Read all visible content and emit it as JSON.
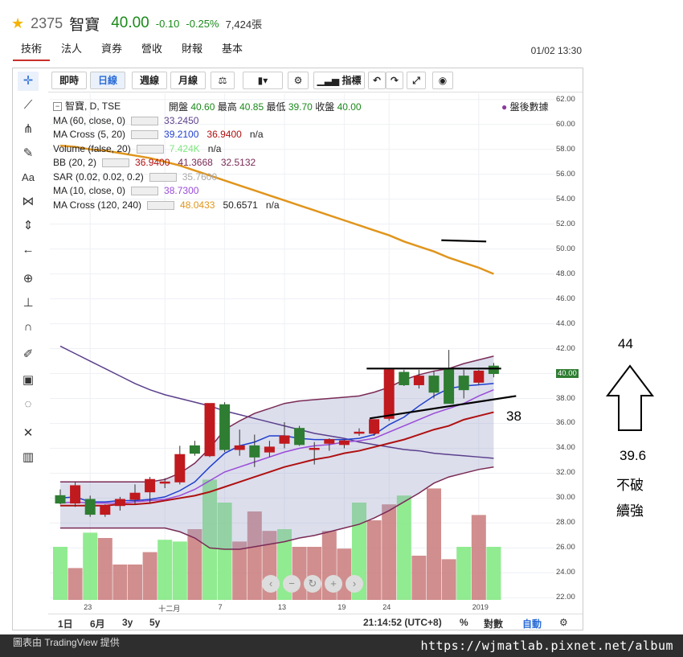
{
  "header": {
    "code": "2375",
    "name": "智寶",
    "price": "40.00",
    "change": "-0.10",
    "change_pct": "-0.25%",
    "volume": "7,424張",
    "star_icon": "star-icon"
  },
  "tabs": [
    "技術",
    "法人",
    "資券",
    "營收",
    "財報",
    "基本"
  ],
  "timestamp": "01/02 13:30",
  "toolbar": {
    "buttons": [
      "即時",
      "日線",
      "週線",
      "月線",
      "指標"
    ],
    "selected": "日線"
  },
  "legend": {
    "symbol": "智寶, D, TSE",
    "ohlc": {
      "open_label": "開盤",
      "open": "40.60",
      "high_label": "最高",
      "high": "40.85",
      "low_label": "最低",
      "low": "39.70",
      "close_label": "收盤",
      "close": "40.00"
    },
    "after_hours": "盤後數據",
    "rows": [
      {
        "label": "MA (60, close, 0)",
        "values": [
          "33.2450"
        ],
        "colors": [
          "#5b3f8c"
        ]
      },
      {
        "label": "MA Cross (5, 20)",
        "values": [
          "39.2100",
          "36.9400",
          "n/a"
        ],
        "colors": [
          "#1f3fcf",
          "#b01010",
          "#222"
        ]
      },
      {
        "label": "Volume (false, 20)",
        "values": [
          "7.424K",
          "n/a"
        ],
        "colors": [
          "#7ee87e",
          "#222"
        ]
      },
      {
        "label": "BB (20, 2)",
        "values": [
          "36.9400",
          "41.3668",
          "32.5132"
        ],
        "colors": [
          "#b01010",
          "#7a2a55",
          "#7a2a55"
        ]
      },
      {
        "label": "SAR (0.02, 0.02, 0.2)",
        "values": [
          "35.7600"
        ],
        "colors": [
          "#aaa"
        ]
      },
      {
        "label": "MA (10, close, 0)",
        "values": [
          "38.7300"
        ],
        "colors": [
          "#9a4ad8"
        ]
      },
      {
        "label": "MA Cross (120, 240)",
        "values": [
          "48.0433",
          "50.6571",
          "n/a"
        ],
        "colors": [
          "#e0951c",
          "#222",
          "#222"
        ]
      }
    ]
  },
  "chart_data": {
    "type": "candlestick",
    "symbol": "智寶, D, TSE",
    "y_ticks": [
      "62.00",
      "60.00",
      "58.00",
      "56.00",
      "54.00",
      "52.00",
      "50.00",
      "48.00",
      "46.00",
      "44.00",
      "42.00",
      "40.00",
      "38.00",
      "36.00",
      "34.00",
      "32.00",
      "30.00",
      "28.00",
      "26.00",
      "24.00",
      "22.00"
    ],
    "ylim": [
      21.7,
      62.5
    ],
    "current_price": "40.00",
    "x_ticks": [
      {
        "label": "23",
        "i": 2
      },
      {
        "label": "十二月",
        "i": 7
      },
      {
        "label": "7",
        "i": 11
      },
      {
        "label": "13",
        "i": 15
      },
      {
        "label": "19",
        "i": 19
      },
      {
        "label": "24",
        "i": 22
      },
      {
        "label": "2019",
        "i": 28
      }
    ],
    "candles": [
      {
        "o": 30.2,
        "h": 30.7,
        "l": 29.5,
        "c": 29.6
      },
      {
        "o": 29.6,
        "h": 31.3,
        "l": 29.3,
        "c": 31.0
      },
      {
        "o": 29.9,
        "h": 30.2,
        "l": 28.5,
        "c": 28.7
      },
      {
        "o": 28.7,
        "h": 29.5,
        "l": 28.5,
        "c": 29.4
      },
      {
        "o": 29.4,
        "h": 30.1,
        "l": 29.0,
        "c": 29.9
      },
      {
        "o": 29.9,
        "h": 31.1,
        "l": 29.5,
        "c": 30.4
      },
      {
        "o": 30.5,
        "h": 31.7,
        "l": 29.6,
        "c": 31.5
      },
      {
        "o": 31.2,
        "h": 31.6,
        "l": 30.8,
        "c": 31.3
      },
      {
        "o": 31.3,
        "h": 34.2,
        "l": 31.1,
        "c": 33.5
      },
      {
        "o": 34.2,
        "h": 34.6,
        "l": 33.4,
        "c": 33.6
      },
      {
        "o": 33.4,
        "h": 37.6,
        "l": 33.3,
        "c": 37.6
      },
      {
        "o": 37.5,
        "h": 37.7,
        "l": 33.7,
        "c": 33.9
      },
      {
        "o": 33.9,
        "h": 35.5,
        "l": 33.4,
        "c": 34.2
      },
      {
        "o": 34.2,
        "h": 35.1,
        "l": 32.5,
        "c": 33.3
      },
      {
        "o": 33.7,
        "h": 34.6,
        "l": 33.3,
        "c": 34.1
      },
      {
        "o": 34.4,
        "h": 36.1,
        "l": 34.0,
        "c": 35.0
      },
      {
        "o": 35.6,
        "h": 35.8,
        "l": 34.2,
        "c": 34.3
      },
      {
        "o": 34.0,
        "h": 34.5,
        "l": 32.7,
        "c": 34.0
      },
      {
        "o": 34.4,
        "h": 34.8,
        "l": 33.8,
        "c": 34.7
      },
      {
        "o": 34.3,
        "h": 34.7,
        "l": 34.0,
        "c": 34.6
      },
      {
        "o": 35.3,
        "h": 35.6,
        "l": 35.0,
        "c": 35.3
      },
      {
        "o": 35.2,
        "h": 36.3,
        "l": 35.0,
        "c": 36.3
      },
      {
        "o": 36.4,
        "h": 40.4,
        "l": 36.2,
        "c": 40.3
      },
      {
        "o": 40.1,
        "h": 40.3,
        "l": 39.0,
        "c": 39.1
      },
      {
        "o": 39.1,
        "h": 40.3,
        "l": 38.8,
        "c": 39.8
      },
      {
        "o": 39.8,
        "h": 40.2,
        "l": 38.0,
        "c": 38.5
      },
      {
        "o": 40.3,
        "h": 41.9,
        "l": 37.6,
        "c": 37.6
      },
      {
        "o": 39.8,
        "h": 40.3,
        "l": 38.0,
        "c": 38.7
      },
      {
        "o": 39.3,
        "h": 40.3,
        "l": 39.1,
        "c": 40.2
      },
      {
        "o": 40.6,
        "h": 40.85,
        "l": 39.7,
        "c": 40.0
      }
    ],
    "volume": [
      3.0,
      1.8,
      3.8,
      3.5,
      2.0,
      2.0,
      2.7,
      3.4,
      3.3,
      4.0,
      6.8,
      5.5,
      3.3,
      5.0,
      3.9,
      4.0,
      3.0,
      3.0,
      3.9,
      2.9,
      5.5,
      4.5,
      5.4,
      5.9,
      2.5,
      6.3,
      2.3,
      3.0,
      4.8,
      3.0
    ],
    "volume_up": [
      false,
      true,
      false,
      true,
      true,
      true,
      true,
      false,
      false,
      true,
      false,
      false,
      true,
      true,
      true,
      false,
      true,
      true,
      true,
      true,
      false,
      true,
      true,
      false,
      true,
      true,
      true,
      false,
      true,
      false
    ],
    "series": [
      {
        "name": "MA (60, close, 0)",
        "color": "#5b3f8c",
        "values": [
          42.2,
          41.6,
          41.0,
          40.4,
          39.8,
          39.2,
          38.7,
          38.3,
          38.0,
          37.7,
          37.4,
          37.0,
          36.7,
          36.4,
          36.1,
          35.8,
          35.5,
          35.2,
          35.0,
          34.8,
          34.5,
          34.3,
          34.1,
          33.9,
          33.8,
          33.6,
          33.5,
          33.4,
          33.3,
          33.2
        ]
      },
      {
        "name": "MA Cross (5, 20) 5",
        "color": "#1f3fcf",
        "values": [
          30.0,
          30.1,
          29.7,
          29.7,
          29.8,
          29.8,
          29.9,
          30.1,
          30.6,
          31.3,
          32.5,
          33.6,
          34.2,
          34.5,
          35.0,
          35.0,
          34.8,
          34.7,
          34.7,
          34.7,
          34.8,
          35.1,
          35.9,
          36.5,
          37.4,
          38.2,
          38.8,
          39.0,
          39.1,
          39.2
        ]
      },
      {
        "name": "MA Cross (5, 20) 20",
        "color": "#b01010",
        "values": [
          29.4,
          29.4,
          29.4,
          29.4,
          29.5,
          29.5,
          29.6,
          29.8,
          30.0,
          30.2,
          30.5,
          30.9,
          31.3,
          31.7,
          32.1,
          32.5,
          32.8,
          33.1,
          33.3,
          33.6,
          33.8,
          34.1,
          34.4,
          34.7,
          35.1,
          35.5,
          35.8,
          36.3,
          36.6,
          36.9
        ]
      },
      {
        "name": "MA (10, close, 0)",
        "color": "#9a4ad8",
        "values": [
          29.6,
          29.7,
          29.6,
          29.6,
          29.6,
          29.7,
          29.8,
          29.9,
          30.2,
          30.7,
          31.4,
          32.1,
          32.5,
          32.9,
          33.3,
          33.7,
          34.0,
          34.2,
          34.3,
          34.5,
          34.6,
          34.8,
          35.3,
          35.8,
          36.3,
          36.8,
          37.2,
          37.6,
          38.2,
          38.7
        ]
      },
      {
        "name": "BB (20, 2) upper",
        "color": "#7a2a55",
        "values": [
          31.3,
          31.3,
          31.3,
          31.3,
          31.3,
          31.3,
          31.3,
          31.5,
          32.0,
          32.8,
          34.0,
          35.5,
          36.2,
          36.8,
          37.2,
          37.6,
          37.8,
          37.9,
          38.0,
          38.1,
          38.2,
          38.5,
          38.9,
          39.5,
          39.9,
          40.2,
          40.4,
          40.8,
          41.1,
          41.4
        ]
      },
      {
        "name": "BB (20, 2) lower",
        "color": "#7a2a55",
        "values": [
          27.6,
          27.6,
          27.6,
          27.6,
          27.6,
          27.6,
          27.6,
          27.6,
          27.3,
          26.8,
          26.0,
          25.9,
          25.9,
          26.1,
          26.3,
          26.5,
          26.8,
          27.0,
          27.3,
          27.6,
          27.9,
          28.4,
          29.0,
          29.7,
          30.4,
          31.2,
          31.7,
          32.0,
          32.3,
          32.5
        ]
      },
      {
        "name": "MA Cross (120, 240) 120",
        "color": "#e0951c",
        "values": [
          58.3,
          58.2,
          58.0,
          57.9,
          57.7,
          57.5,
          57.3,
          57.0,
          56.7,
          56.3,
          55.9,
          55.5,
          55.1,
          54.7,
          54.3,
          53.9,
          53.5,
          53.1,
          52.7,
          52.3,
          51.9,
          51.5,
          51.1,
          50.6,
          50.2,
          49.8,
          49.3,
          48.9,
          48.5,
          48.0
        ]
      }
    ],
    "annotation_lines": [
      {
        "x1": 20.5,
        "y1": 40.4,
        "x2": 29.5,
        "y2": 40.4
      },
      {
        "x1": 20.7,
        "y1": 36.4,
        "x2": 30.5,
        "y2": 38.2
      },
      {
        "x1": 25.5,
        "y1": 50.7,
        "x2": 28.5,
        "y2": 50.6
      }
    ]
  },
  "bottom_bar": {
    "ranges": [
      "1日",
      "6月",
      "3y",
      "5y"
    ],
    "clock": "21:14:52 (UTC+8)",
    "pct": "%",
    "log": "對數",
    "auto": "自動"
  },
  "notes": {
    "top": "44",
    "right_low": "38",
    "bottom": "39.6",
    "line1": "不破",
    "line2": "續強"
  },
  "footer": {
    "source": "圖表由 TradingView 提供",
    "url": "https://wjmatlab.pixnet.net/album"
  }
}
